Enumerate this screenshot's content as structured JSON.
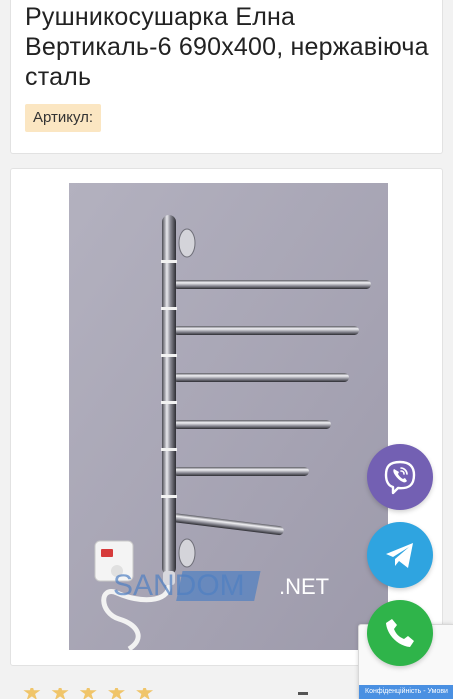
{
  "product": {
    "title": "Рушникосушарка Елна Вертикаль-6 690х400, нержавіюча сталь",
    "sku_label": "Артикул:"
  },
  "image": {
    "watermark_brand": "SANDOM",
    "watermark_domain": ".NET"
  },
  "rating": {
    "stars_visible": 5
  },
  "floating_buttons": [
    {
      "name": "viber",
      "icon": "viber-icon",
      "color": "#7360b3"
    },
    {
      "name": "telegram",
      "icon": "telegram-icon",
      "color": "#2fa4e0"
    },
    {
      "name": "phone",
      "icon": "phone-icon",
      "color": "#2fb44a"
    }
  ],
  "recaptcha": {
    "privacy_link": "Конфіденційність",
    "separator": " - ",
    "terms_link": "Умови"
  },
  "colors": {
    "background": "#f2f2f2",
    "sku_badge": "#fbe6c2",
    "photo_backdrop": "#a9a7b6",
    "star": "#f0c56a"
  }
}
